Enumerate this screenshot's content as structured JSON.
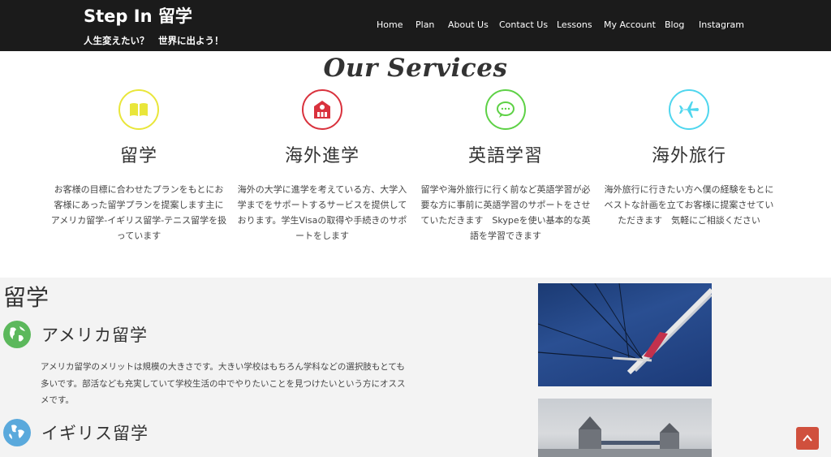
{
  "header": {
    "brand": "Step In 留学",
    "tagline": "人生変えたい？　世界に出よう！",
    "nav": [
      "Home",
      "Plan",
      "About Us",
      "Contact Us",
      "Lessons",
      "My Account",
      "Blog",
      "Instagram"
    ]
  },
  "services": {
    "title": "Our Services",
    "items": [
      {
        "title": "留学",
        "icon": "book-icon",
        "color": "#e9e63a",
        "desc": "お客様の目標に合わせたプランをもとにお客様にあった留学プランを提案します主に\nアメリカ留学-イギリス留学-テニス留学を扱っています"
      },
      {
        "title": "海外進学",
        "icon": "school-icon",
        "color": "#d9323d",
        "desc": "海外の大学に進学を考えている方、大学入学までをサポートするサービスを提供しております。学生Visaの取得や手続きのサポートをします"
      },
      {
        "title": "英語学習",
        "icon": "chat-bubble-icon",
        "color": "#5ed146",
        "desc": "留学や海外旅行に行く前など英語学習が必要な方に事前に英語学習のサポートをさせていただきます　Skypeを使い基本的な英語を学習できます"
      },
      {
        "title": "海外旅行",
        "icon": "airplane-icon",
        "color": "#4fd6ee",
        "desc": "海外旅行に行きたい方へ僕の経験をもとにベストな計画を立てお客様に提案させていただきます　気軽にご相談ください"
      }
    ]
  },
  "ryugaku": {
    "heading": "留学",
    "america": {
      "title": "アメリカ留学",
      "icon": "globe-americas-icon",
      "color": "#5cb85c",
      "desc": "アメリカ留学のメリットは規模の大きさです。大きい学校はもちろん学科などの選択肢もとても多いです。部活なども充実していて学校生活の中でやりたいことを見つけたいという方にオススメです。"
    },
    "uk": {
      "title": "イギリス留学",
      "icon": "globe-europe-icon",
      "color": "#5aa9dc"
    }
  },
  "scroll_top": {
    "icon": "chevron-up-icon",
    "color": "#d0503d"
  }
}
